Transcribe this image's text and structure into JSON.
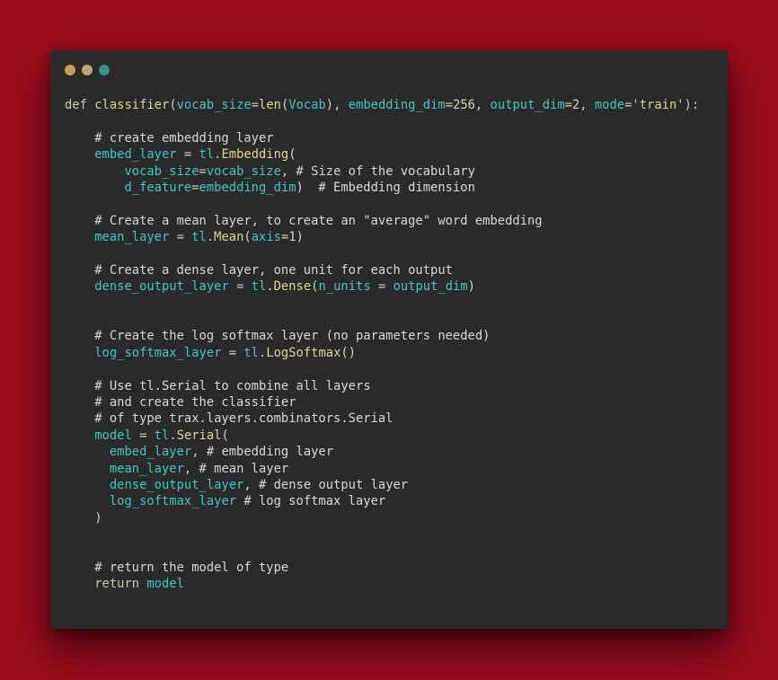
{
  "colors": {
    "background": "#990c1c",
    "window": "#2a2a2a",
    "window_dots": [
      "#c9a14a",
      "#b9a96a",
      "#3a8f8a"
    ]
  },
  "window_controls": [
    {
      "name": "window-dot-1",
      "color": "#c9a14a"
    },
    {
      "name": "window-dot-2",
      "color": "#b9a96a"
    },
    {
      "name": "window-dot-3",
      "color": "#3a8f8a"
    }
  ],
  "code_lines": [
    [
      {
        "t": "def ",
        "c": "kw"
      },
      {
        "t": "classifier",
        "c": "fn"
      },
      {
        "t": "(",
        "c": "pl"
      },
      {
        "t": "vocab_size",
        "c": "id"
      },
      {
        "t": "=",
        "c": "pl"
      },
      {
        "t": "len",
        "c": "fn"
      },
      {
        "t": "(",
        "c": "pl"
      },
      {
        "t": "Vocab",
        "c": "id"
      },
      {
        "t": "), ",
        "c": "pl"
      },
      {
        "t": "embedding_dim",
        "c": "id"
      },
      {
        "t": "=256, ",
        "c": "pl"
      },
      {
        "t": "output_dim",
        "c": "id"
      },
      {
        "t": "=2, ",
        "c": "pl"
      },
      {
        "t": "mode",
        "c": "id"
      },
      {
        "t": "=",
        "c": "pl"
      },
      {
        "t": "'train'",
        "c": "st"
      },
      {
        "t": "):",
        "c": "pl"
      }
    ],
    [],
    [
      {
        "t": "    # create embedding layer",
        "c": "cm"
      }
    ],
    [
      {
        "t": "    ",
        "c": "pl"
      },
      {
        "t": "embed_layer",
        "c": "id"
      },
      {
        "t": " = ",
        "c": "pl"
      },
      {
        "t": "tl",
        "c": "id"
      },
      {
        "t": ".",
        "c": "pl"
      },
      {
        "t": "Embedding",
        "c": "fn"
      },
      {
        "t": "(",
        "c": "pl"
      }
    ],
    [
      {
        "t": "        ",
        "c": "pl"
      },
      {
        "t": "vocab_size",
        "c": "id"
      },
      {
        "t": "=",
        "c": "pl"
      },
      {
        "t": "vocab_size",
        "c": "id"
      },
      {
        "t": ", # Size of the vocabulary",
        "c": "cm"
      }
    ],
    [
      {
        "t": "        ",
        "c": "pl"
      },
      {
        "t": "d_feature",
        "c": "id"
      },
      {
        "t": "=",
        "c": "pl"
      },
      {
        "t": "embedding_dim",
        "c": "id"
      },
      {
        "t": ")  # Embedding dimension",
        "c": "cm"
      }
    ],
    [],
    [
      {
        "t": "    # Create a mean layer, to create an \"average\" word embedding",
        "c": "cm"
      }
    ],
    [
      {
        "t": "    ",
        "c": "pl"
      },
      {
        "t": "mean_layer",
        "c": "id"
      },
      {
        "t": " = ",
        "c": "pl"
      },
      {
        "t": "tl",
        "c": "id"
      },
      {
        "t": ".",
        "c": "pl"
      },
      {
        "t": "Mean",
        "c": "fn"
      },
      {
        "t": "(",
        "c": "pl"
      },
      {
        "t": "axis",
        "c": "id"
      },
      {
        "t": "=1)",
        "c": "pl"
      }
    ],
    [],
    [
      {
        "t": "    # Create a dense layer, one unit for each output",
        "c": "cm"
      }
    ],
    [
      {
        "t": "    ",
        "c": "pl"
      },
      {
        "t": "dense_output_layer",
        "c": "id"
      },
      {
        "t": " = ",
        "c": "pl"
      },
      {
        "t": "tl",
        "c": "id"
      },
      {
        "t": ".",
        "c": "pl"
      },
      {
        "t": "Dense",
        "c": "fn"
      },
      {
        "t": "(",
        "c": "pl"
      },
      {
        "t": "n_units",
        "c": "id"
      },
      {
        "t": " = ",
        "c": "pl"
      },
      {
        "t": "output_dim",
        "c": "id"
      },
      {
        "t": ")",
        "c": "pl"
      }
    ],
    [],
    [],
    [
      {
        "t": "    # Create the log softmax layer (no parameters needed)",
        "c": "cm"
      }
    ],
    [
      {
        "t": "    ",
        "c": "pl"
      },
      {
        "t": "log_softmax_layer",
        "c": "id"
      },
      {
        "t": " = ",
        "c": "pl"
      },
      {
        "t": "tl",
        "c": "id"
      },
      {
        "t": ".",
        "c": "pl"
      },
      {
        "t": "LogSoftmax",
        "c": "fn"
      },
      {
        "t": "()",
        "c": "pl"
      }
    ],
    [],
    [
      {
        "t": "    # Use tl.Serial to combine all layers",
        "c": "cm"
      }
    ],
    [
      {
        "t": "    # and create the classifier",
        "c": "cm"
      }
    ],
    [
      {
        "t": "    # of type trax.layers.combinators.Serial",
        "c": "cm"
      }
    ],
    [
      {
        "t": "    ",
        "c": "pl"
      },
      {
        "t": "model",
        "c": "id"
      },
      {
        "t": " = ",
        "c": "pl"
      },
      {
        "t": "tl",
        "c": "id"
      },
      {
        "t": ".",
        "c": "pl"
      },
      {
        "t": "Serial",
        "c": "fn"
      },
      {
        "t": "(",
        "c": "pl"
      }
    ],
    [
      {
        "t": "      ",
        "c": "pl"
      },
      {
        "t": "embed_layer",
        "c": "id"
      },
      {
        "t": ", # embedding layer",
        "c": "cm"
      }
    ],
    [
      {
        "t": "      ",
        "c": "pl"
      },
      {
        "t": "mean_layer",
        "c": "id"
      },
      {
        "t": ", # mean layer",
        "c": "cm"
      }
    ],
    [
      {
        "t": "      ",
        "c": "pl"
      },
      {
        "t": "dense_output_layer",
        "c": "id"
      },
      {
        "t": ", # dense output layer",
        "c": "cm"
      }
    ],
    [
      {
        "t": "      ",
        "c": "pl"
      },
      {
        "t": "log_softmax_layer",
        "c": "id"
      },
      {
        "t": " # log softmax layer",
        "c": "cm"
      }
    ],
    [
      {
        "t": "    )",
        "c": "pl"
      }
    ],
    [],
    [],
    [
      {
        "t": "    # return the model of type",
        "c": "cm"
      }
    ],
    [
      {
        "t": "    return ",
        "c": "kw"
      },
      {
        "t": "model",
        "c": "id"
      }
    ]
  ]
}
